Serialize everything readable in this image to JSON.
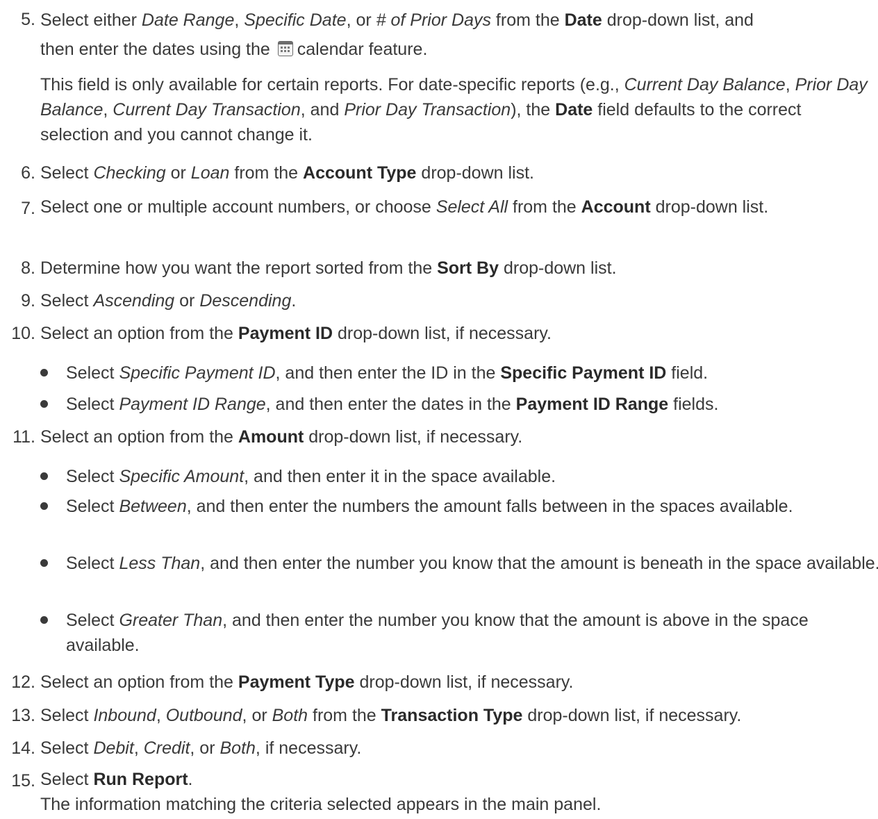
{
  "steps": {
    "s5": {
      "num": "5.",
      "t1": "Select either ",
      "i1": "Date Range",
      "t2": ", ",
      "i2": "Specific Date",
      "t3": ", or ",
      "i3": "# of Prior Days",
      "t4": " from the ",
      "b1": "Date",
      "t5": " drop-down list, and",
      "line2_a": "then enter the dates using the",
      "line2_b": "calendar feature.",
      "icon": "calendar-icon",
      "note": {
        "t1": "This field is only available for certain reports. For date-specific reports (e.g., ",
        "i1": "Current Day Balance",
        "t2": ", ",
        "i2": "Prior Day Balance",
        "t3": ", ",
        "i3": "Current Day Transaction",
        "t4": ", and ",
        "i4": "Prior Day Transaction",
        "t5": "), the ",
        "b1": "Date",
        "t6": " field defaults to the correct selection and you cannot change it."
      }
    },
    "s6": {
      "num": "6.",
      "t1": "Select ",
      "i1": "Checking",
      "t2": " or ",
      "i2": "Loan",
      "t3": " from the ",
      "b1": "Account Type",
      "t4": " drop-down list."
    },
    "s7": {
      "num": "7.",
      "t1": "Select one or multiple account numbers, or choose ",
      "i1": "Select All",
      "t2": " from the ",
      "b1": "Account",
      "t3": " drop-down list."
    },
    "s8": {
      "num": "8.",
      "t1": "Determine how you want the report sorted from the ",
      "b1": "Sort By",
      "t2": " drop-down list."
    },
    "s9": {
      "num": "9.",
      "t1": "Select ",
      "i1": "Ascending",
      "t2": " or ",
      "i2": "Descending",
      "t3": "."
    },
    "s10": {
      "num": "10.",
      "t1": "Select an option from the ",
      "b1": "Payment ID",
      "t2": " drop-down list, if necessary.",
      "bullets": [
        {
          "t1": "Select ",
          "i1": "Specific Payment ID",
          "t2": ", and then enter the ID in the ",
          "b1": "Specific Payment ID",
          "t3": " field."
        },
        {
          "t1": "Select ",
          "i1": "Payment ID Range",
          "t2": ", and then enter the dates in the ",
          "b1": "Payment ID Range",
          "t3": " fields."
        }
      ]
    },
    "s11": {
      "num": "11.",
      "t1": "Select an option from the ",
      "b1": "Amount",
      "t2": " drop-down list, if necessary.",
      "bullets": [
        {
          "t1": "Select ",
          "i1": "Specific Amount",
          "t2": ", and then enter it in the space available."
        },
        {
          "t1": "Select ",
          "i1": "Between",
          "t2": ", and then enter the numbers the amount falls between in the spaces available."
        },
        {
          "t1": "Select ",
          "i1": "Less Than",
          "t2": ", and then enter the number you know that the amount is beneath in the space available."
        },
        {
          "t1": "Select ",
          "i1": "Greater Than",
          "t2": ", and then enter the number you know that the amount is above in the space available."
        }
      ]
    },
    "s12": {
      "num": "12.",
      "t1": "Select an option from the ",
      "b1": "Payment Type",
      "t2": " drop-down list, if necessary."
    },
    "s13": {
      "num": "13.",
      "t1": "Select ",
      "i1": "Inbound",
      "t2": ", ",
      "i2": "Outbound",
      "t3": ", or ",
      "i3": "Both",
      "t4": " from the ",
      "b1": "Transaction Type",
      "t5": " drop-down list, if necessary."
    },
    "s14": {
      "num": "14.",
      "t1": "Select ",
      "i1": "Debit",
      "t2": ", ",
      "i2": "Credit",
      "t3": ", or ",
      "i3": "Both",
      "t4": ", if necessary."
    },
    "s15": {
      "num": "15.",
      "t1": "Select ",
      "b1": "Run Report",
      "t2": ".",
      "note": "The information matching the criteria selected appears in the main panel."
    }
  }
}
